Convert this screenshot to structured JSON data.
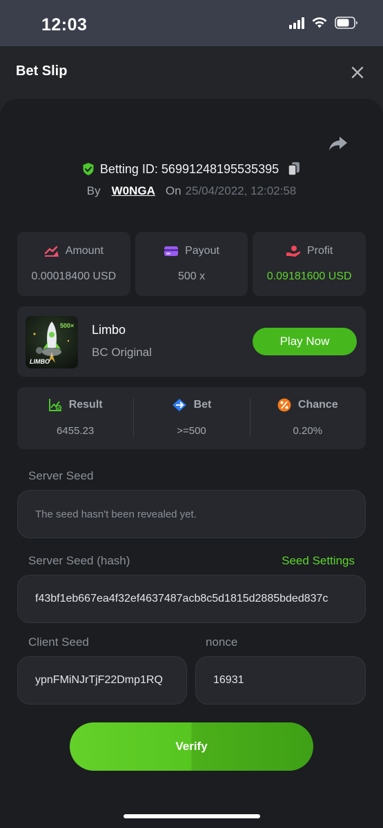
{
  "status": {
    "time": "12:03"
  },
  "header": {
    "title": "Bet Slip"
  },
  "bet": {
    "id_label": "Betting ID: 56991248195535395",
    "by_label": "By",
    "user": "W0NGA",
    "on_label": "On",
    "date": "25/04/2022, 12:02:58"
  },
  "stats": {
    "amount": {
      "label": "Amount",
      "value": "0.00018400 USD"
    },
    "payout": {
      "label": "Payout",
      "value": "500 x"
    },
    "profit": {
      "label": "Profit",
      "value": "0.09181600 USD"
    }
  },
  "game": {
    "name": "Limbo",
    "provider": "BC Original",
    "thumb_label": "LIMBO",
    "thumb_badge": "500×",
    "play_label": "Play Now"
  },
  "result": {
    "result": {
      "label": "Result",
      "value": "6455.23"
    },
    "bet": {
      "label": "Bet",
      "value": ">=500"
    },
    "chance": {
      "label": "Chance",
      "value": "0.20%"
    }
  },
  "seeds": {
    "server_seed_label": "Server Seed",
    "server_seed_placeholder": "The seed hasn't been revealed yet.",
    "server_hash_label": "Server Seed (hash)",
    "seed_settings_label": "Seed Settings",
    "server_hash_value": "f43bf1eb667ea4f32ef4637487acb8c5d1815d2885bded837c",
    "client_seed_label": "Client Seed",
    "client_seed_value": "ypnFMiNJrTjF22Dmp1RQ",
    "nonce_label": "nonce",
    "nonce_value": "16931"
  },
  "actions": {
    "verify_label": "Verify"
  },
  "colors": {
    "accent_green": "#5fd52c",
    "button_green": "#46b81d",
    "background": "#1b1d21",
    "panel": "#26282d"
  }
}
